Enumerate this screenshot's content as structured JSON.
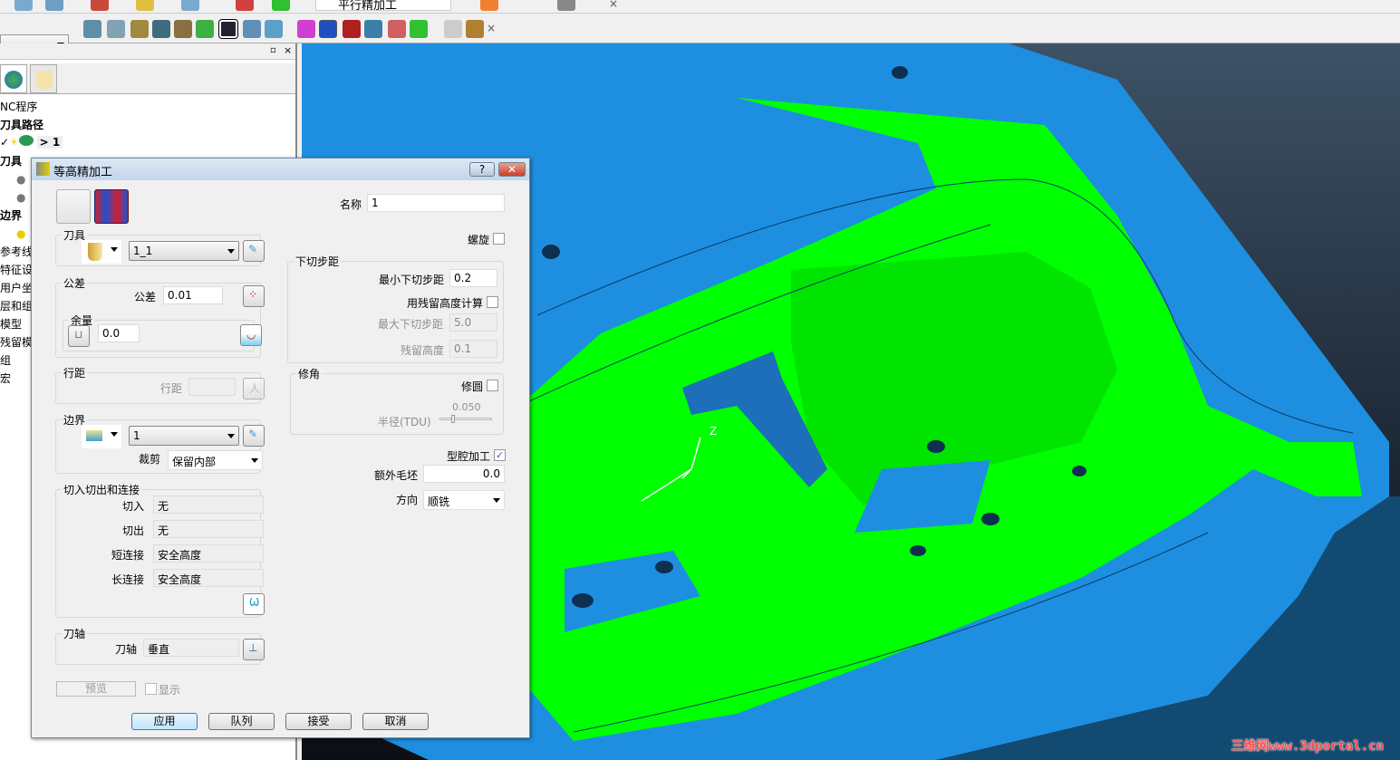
{
  "toolbar": {
    "strategy_combo": "平行精加工",
    "colors": {
      "accent": "#3c7fb1"
    }
  },
  "explorer": {
    "tree": [
      {
        "label": "NC程序",
        "bold": false
      },
      {
        "label": "刀具路径",
        "bold": true
      },
      {
        "label": "> 1",
        "bold": true
      },
      {
        "label": "刀具",
        "bold": true
      },
      {
        "label": "边界",
        "bold": true
      },
      {
        "label": "参考线",
        "bold": false
      },
      {
        "label": "特征设",
        "bold": false
      },
      {
        "label": "用户坐",
        "bold": false
      },
      {
        "label": "层和组",
        "bold": false
      },
      {
        "label": "模型",
        "bold": false
      },
      {
        "label": "残留模",
        "bold": false
      },
      {
        "label": "组",
        "bold": false
      },
      {
        "label": "宏",
        "bold": false
      }
    ]
  },
  "dialog": {
    "title": "等高精加工",
    "help": "?",
    "close": "✕",
    "name_label": "名称",
    "name_value": "1",
    "tool_group": "刀具",
    "tool_value": "1_1",
    "tolerance_group": "公差",
    "tolerance_label": "公差",
    "tolerance_value": "0.01",
    "thickness_group": "余量",
    "thickness_value": "0.0",
    "stepover_group": "行距",
    "stepover_label": "行距",
    "stepover_value": "",
    "boundary_group": "边界",
    "boundary_value": "1",
    "trim_label": "裁剪",
    "trim_value": "保留内部",
    "leads_group": "切入切出和连接",
    "lead_in_label": "切入",
    "lead_in_value": "无",
    "lead_out_label": "切出",
    "lead_out_value": "无",
    "short_link_label": "短连接",
    "short_link_value": "安全高度",
    "long_link_label": "长连接",
    "long_link_value": "安全高度",
    "axis_group": "刀轴",
    "axis_label": "刀轴",
    "axis_value": "垂直",
    "spiral_label": "螺旋",
    "spiral_checked": false,
    "stepdown_group": "下切步距",
    "min_stepdown_label": "最小下切步距",
    "min_stepdown_value": "0.2",
    "use_cusp_label": "用残留高度计算",
    "use_cusp_checked": false,
    "max_stepdown_label": "最大下切步距",
    "max_stepdown_value": "5.0",
    "cusp_label": "残留高度",
    "cusp_value": "0.1",
    "corner_group": "修角",
    "round_label": "修圆",
    "round_checked": false,
    "radius_value": "0.050",
    "radius_label": "半径(TDU)",
    "pocket_label": "型腔加工",
    "pocket_checked": true,
    "extra_stock_label": "额外毛坯",
    "extra_stock_value": "0.0",
    "direction_label": "方向",
    "direction_value": "顺铣",
    "preview_button": "预览",
    "show_label": "显示",
    "apply_button": "应用",
    "queue_button": "队列",
    "accept_button": "接受",
    "cancel_button": "取消"
  },
  "viewport": {
    "axis_label": "Z",
    "watermark": "三维网www.3dportal.cn",
    "colors": {
      "model": "#1e8fe0",
      "toolpath": "#00ff00",
      "background": "#1b2633"
    }
  }
}
